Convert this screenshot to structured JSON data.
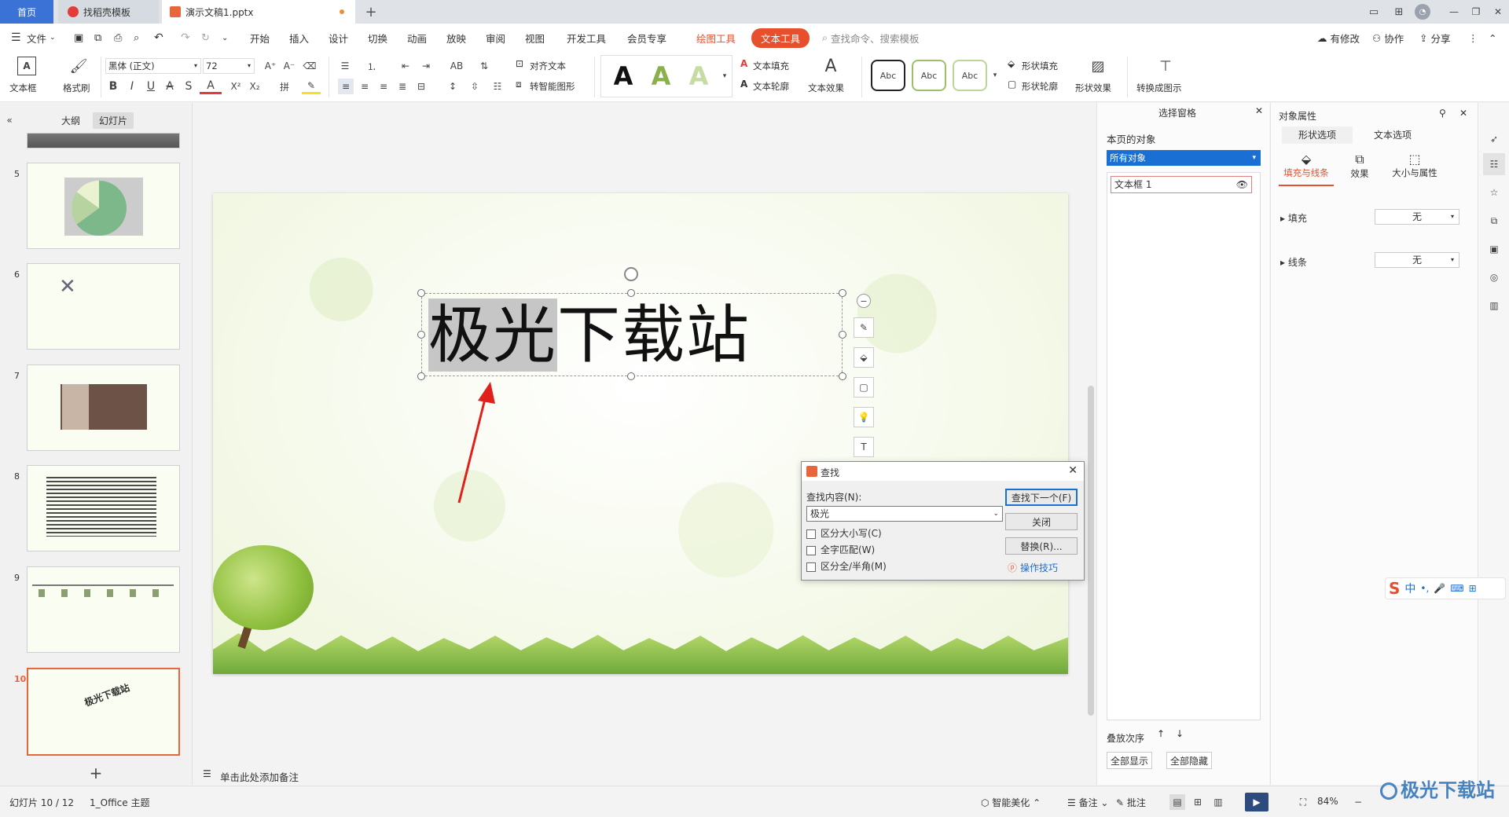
{
  "tabs": {
    "home": "首页",
    "template": "找稻壳模板",
    "doc": "演示文稿1.pptx",
    "new_tab": "+"
  },
  "menu": {
    "file": "文件",
    "items": [
      "开始",
      "插入",
      "设计",
      "切换",
      "动画",
      "放映",
      "审阅",
      "视图",
      "开发工具",
      "会员专享"
    ],
    "drawing_tools": "绘图工具",
    "text_tools": "文本工具",
    "search": "查找命令、搜索模板",
    "modify": "有修改",
    "collab": "协作",
    "share": "分享"
  },
  "ribbon": {
    "textbox": "文本框",
    "format_painter": "格式刷",
    "font_name": "黑体 (正文)",
    "font_size": "72",
    "align_text": "对齐文本",
    "smart_shape": "转智能图形",
    "text_fill": "文本填充",
    "text_outline": "文本轮廓",
    "text_effect": "文本效果",
    "abc": "Abc",
    "shape_fill": "形状填充",
    "shape_outline": "形状轮廓",
    "shape_effect": "形状效果",
    "convert": "转换成图示"
  },
  "left_panel": {
    "outline": "大纲",
    "slides": "幻灯片",
    "slide_numbers": [
      "5",
      "6",
      "7",
      "8",
      "9",
      "10"
    ],
    "add": "+"
  },
  "slide": {
    "title_highlight": "极光",
    "title_rest": "下载站"
  },
  "notes_placeholder": "单击此处添加备注",
  "find_dialog": {
    "title": "查找",
    "find_label": "查找内容(N):",
    "find_value": "极光",
    "match_case": "区分大小写(C)",
    "whole_word": "全字匹配(W)",
    "width_match": "区分全/半角(M)",
    "find_next": "查找下一个(F)",
    "close": "关闭",
    "replace": "替换(R)...",
    "tips": "操作技巧"
  },
  "selection_pane": {
    "title": "选择窗格",
    "page_objects": "本页的对象",
    "filter": "所有对象",
    "item": "文本框 1",
    "stack_order": "叠放次序",
    "show_all": "全部显示",
    "hide_all": "全部隐藏"
  },
  "property_pane": {
    "title": "对象属性",
    "shape_options": "形状选项",
    "text_options": "文本选项",
    "fill_line": "填充与线条",
    "effect": "效果",
    "size_props": "大小与属性",
    "fill": "填充",
    "line": "线条",
    "fill_value": "无",
    "line_value": "无"
  },
  "status": {
    "slide_info": "幻灯片 10 / 12",
    "theme": "1_Office 主题",
    "beautify": "智能美化",
    "notes": "备注",
    "comments": "批注",
    "zoom": "84%"
  },
  "ime": {
    "mode": "中"
  },
  "watermark": "极光下载站",
  "colors": {
    "accent": "#e8663c",
    "text_tool_tab": "#e8502d",
    "selection_blue": "#1a6fd4"
  }
}
